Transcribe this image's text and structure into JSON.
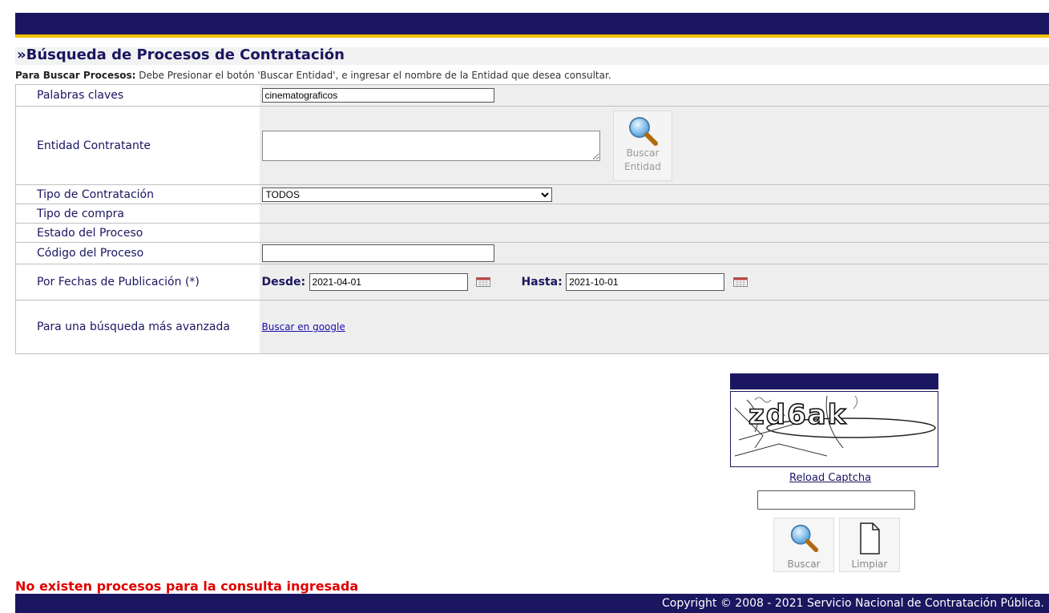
{
  "header": {
    "title": "»Búsqueda de Procesos de Contratación"
  },
  "instructions": {
    "bold": "Para Buscar Procesos:",
    "text": " Debe Presionar el botón 'Buscar Entidad', e ingresar el nombre de la Entidad que desea consultar."
  },
  "form": {
    "keywords": {
      "label": "Palabras claves",
      "value": "cinematograficos"
    },
    "entity": {
      "label": "Entidad Contratante",
      "value": "",
      "button_line1": "Buscar",
      "button_line2": "Entidad"
    },
    "contract_type": {
      "label": "Tipo de Contratación",
      "selected": "TODOS"
    },
    "purchase_type": {
      "label": "Tipo de compra"
    },
    "process_state": {
      "label": "Estado del Proceso"
    },
    "process_code": {
      "label": "Código del Proceso",
      "value": ""
    },
    "dates": {
      "label": "Por Fechas de Publicación (*)",
      "from_label": "Desde:",
      "from_value": "2021-04-01",
      "to_label": "Hasta:",
      "to_value": "2021-10-01"
    },
    "advanced": {
      "label": "Para una búsqueda más avanzada",
      "link": "Buscar en google"
    }
  },
  "captcha": {
    "text": "zd6ak",
    "reload": "Reload Captcha",
    "input_value": ""
  },
  "buttons": {
    "search": "Buscar",
    "clear": "Limpiar"
  },
  "message": "No existen procesos para la consulta ingresada",
  "footer": "Copyright © 2008 - 2021 Servicio Nacional de Contratación Pública.",
  "icons": {
    "search": "magnifier-icon",
    "calendar": "calendar-icon",
    "document": "blank-document-icon"
  },
  "colors": {
    "navy": "#1b1660",
    "accent": "#f2c200",
    "error": "#e00000"
  }
}
